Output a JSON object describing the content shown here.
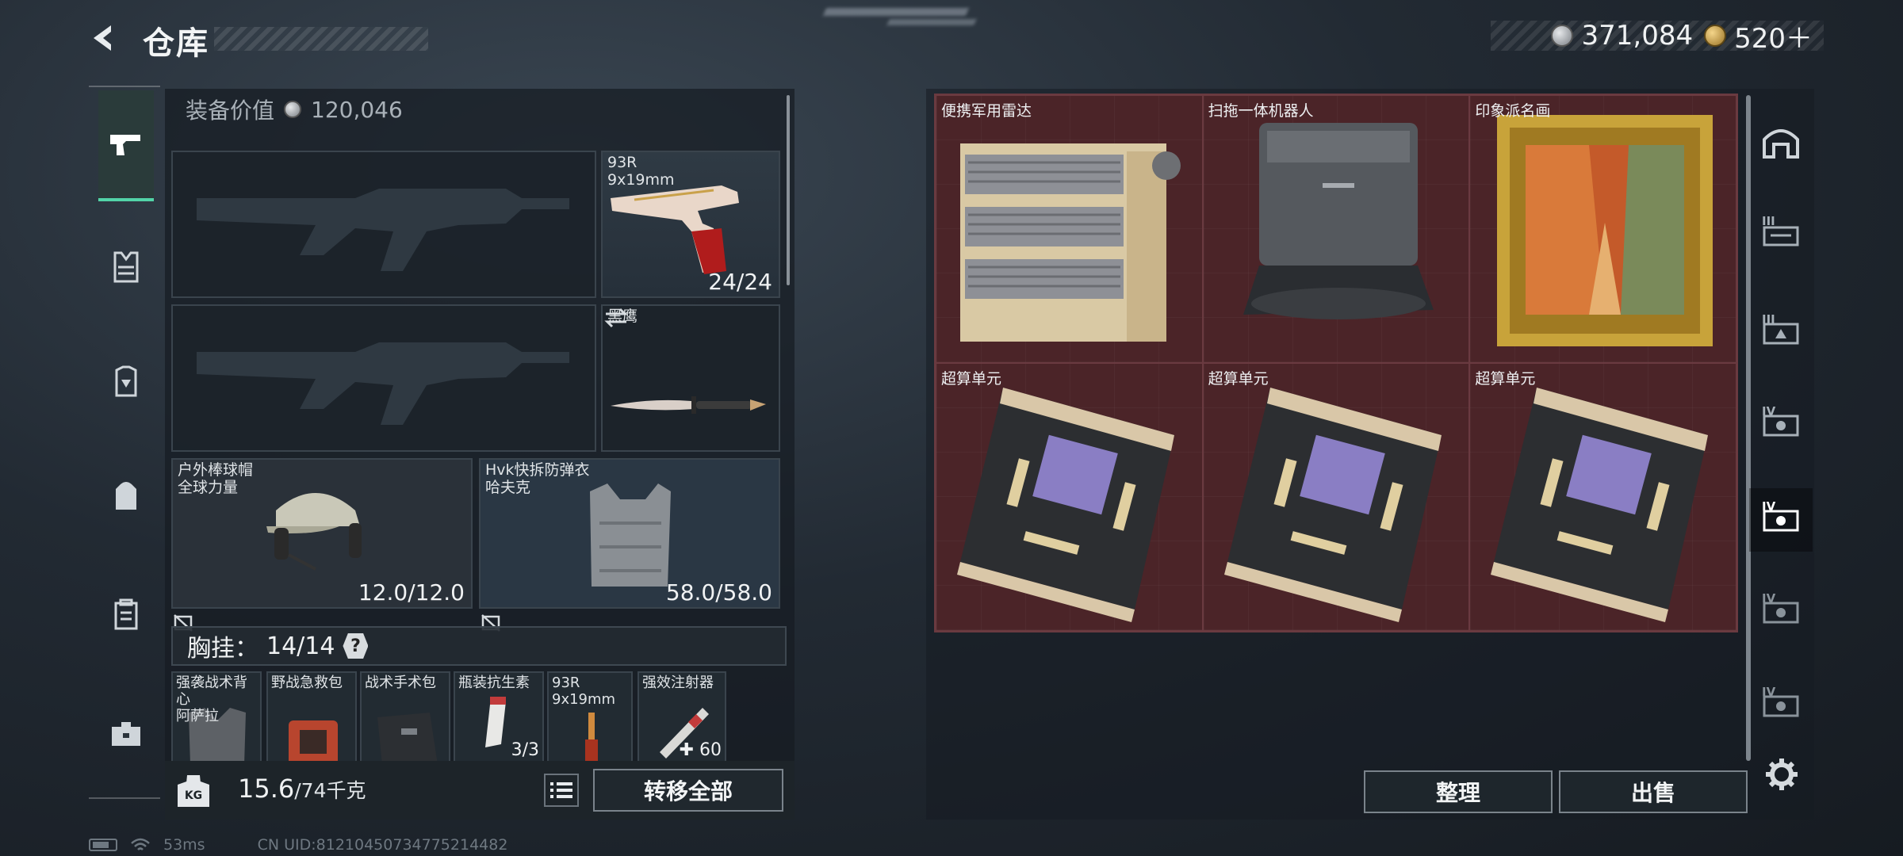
{
  "header": {
    "title": "仓库"
  },
  "currency": {
    "silver": "371,084",
    "gold": "520＋"
  },
  "inventory": {
    "equip_value_label": "装备价值",
    "equip_value": "120,046",
    "pistol": {
      "name_line1": "93R",
      "name_line2": "9x19mm",
      "ammo": "24/24"
    },
    "melee": {
      "name": "黑鹰"
    },
    "helmet": {
      "name_line1": "户外棒球帽",
      "name_line2": "全球力量",
      "durability": "12.0/12.0"
    },
    "armor": {
      "name_line1": "Hvk快拆防弹衣",
      "name_line2": "哈夫克",
      "durability": "58.0/58.0"
    },
    "chest": {
      "label": "胸挂：",
      "count": "14/14",
      "help": "?"
    },
    "chest_items": [
      {
        "name_line1": "强袭战术背心",
        "name_line2": "阿萨拉",
        "value": ""
      },
      {
        "name_line1": "野战急救包",
        "name_line2": "",
        "value": ""
      },
      {
        "name_line1": "战术手术包",
        "name_line2": "",
        "value": ""
      },
      {
        "name_line1": "瓶装抗生素",
        "name_line2": "",
        "value": "3/3"
      },
      {
        "name_line1": "93R",
        "name_line2": "9x19mm",
        "value": ""
      },
      {
        "name_line1": "强效注射器",
        "name_line2": "",
        "value": "✚ 60"
      }
    ],
    "weight": {
      "current": "15.6",
      "max": "/74千克",
      "icon_text": "KG"
    },
    "transfer_all": "转移全部"
  },
  "storage": {
    "items": [
      {
        "name": "便携军用雷达"
      },
      {
        "name": "扫拖一体机器人"
      },
      {
        "name": "印象派名画"
      },
      {
        "name": "超算单元"
      },
      {
        "name": "超算单元"
      },
      {
        "name": "超算单元"
      }
    ],
    "sort_button": "整理",
    "sell_button": "出售"
  },
  "right_nav": {
    "labels": [
      "",
      "III",
      "III",
      "IV",
      "IV",
      "IV",
      "IV"
    ]
  },
  "status_bar": {
    "ping": "53ms",
    "uid": "CN UID:8121045073477521448​2"
  },
  "colors": {
    "accent": "#52d4a8",
    "storage_bg": "#4b2428"
  }
}
